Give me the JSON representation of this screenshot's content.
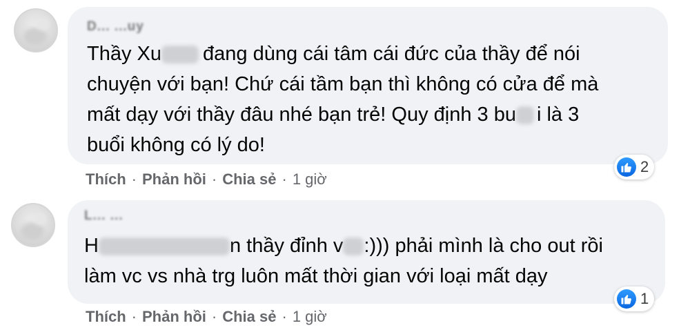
{
  "comments": [
    {
      "author": "D... ...uy",
      "lines": [
        [
          "Thầy Xu",
          "đang dùng cái tâm cái đức của thầy để nói"
        ],
        [
          "chuyện với bạn! Chứ cái tầm bạn thì không có cửa để mà"
        ],
        [
          "mất dạy với thầy đâu nhé bạn trẻ! Quy định 3 bu",
          "i là 3"
        ],
        [
          "buổi không có lý do!"
        ]
      ],
      "reaction_count": "2",
      "actions": {
        "like": "Thích",
        "reply": "Phản hồi",
        "share": "Chia sẻ",
        "time": "1 giờ"
      }
    },
    {
      "author": "L... ...",
      "lines": [
        [
          "H",
          "n thầy đỉnh v",
          ":))) phải mình là cho out rồi"
        ],
        [
          "làm vc vs nhà trg luôn mất thời gian với loại mất dạy"
        ]
      ],
      "reaction_count": "1",
      "actions": {
        "like": "Thích",
        "reply": "Phản hồi",
        "share": "Chia sẻ",
        "time": "1 giờ"
      }
    }
  ],
  "colors": {
    "bubble": "#f0f2f5",
    "like": "#1877f2",
    "meta": "#65676b"
  },
  "icons": {
    "reaction": "like-thumbs-up-icon"
  }
}
